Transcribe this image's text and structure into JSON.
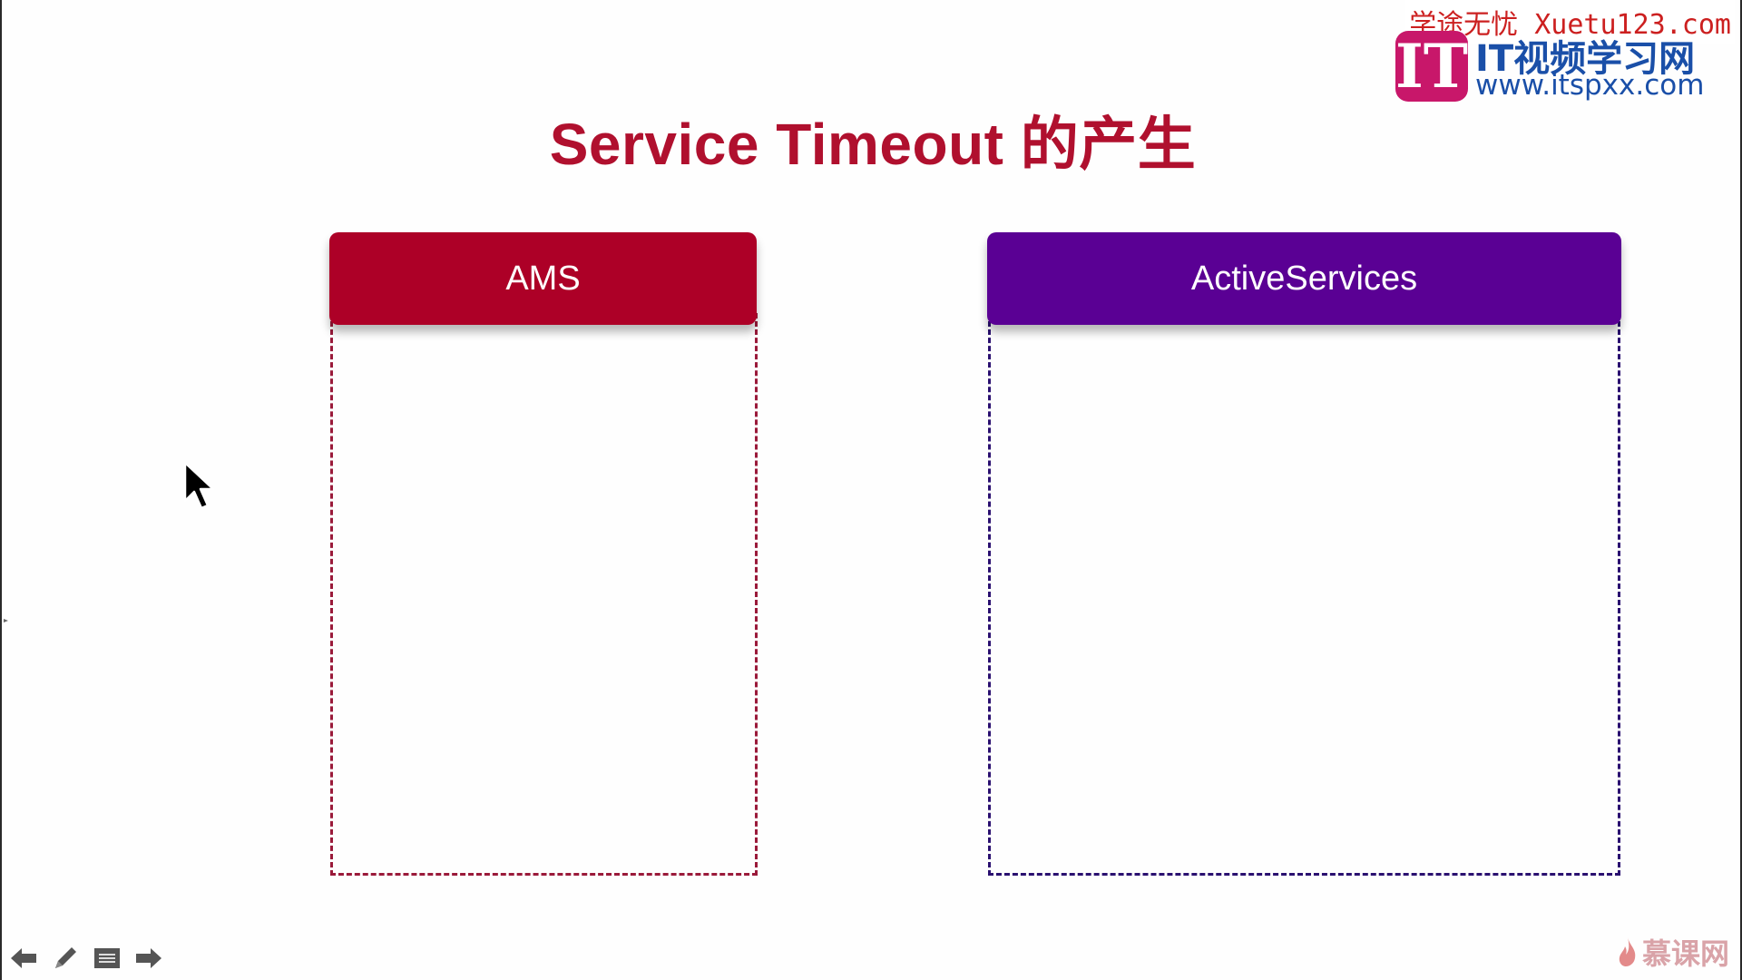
{
  "slide": {
    "title": "Service Timeout 的产生"
  },
  "boxes": {
    "ams": {
      "label": "AMS",
      "color": "#ad0027"
    },
    "active_services": {
      "label": "ActiveServices",
      "color": "#5a0094"
    }
  },
  "watermark": {
    "top_text": "学途无忧 Xuetu123.com",
    "logo_mark": "IT",
    "logo_line1": "IT视频学习网",
    "logo_line2": "www.itspxx.com"
  },
  "toolbar": {
    "icons": [
      "arrow-left-icon",
      "pen-icon",
      "menu-icon",
      "arrow-right-icon"
    ]
  },
  "brand_bottom": {
    "text": "慕课网",
    "icon": "flame-icon"
  },
  "colors": {
    "title": "#b0102e",
    "ams_border": "#9a1a3a",
    "active_services_border": "#2a1070"
  }
}
